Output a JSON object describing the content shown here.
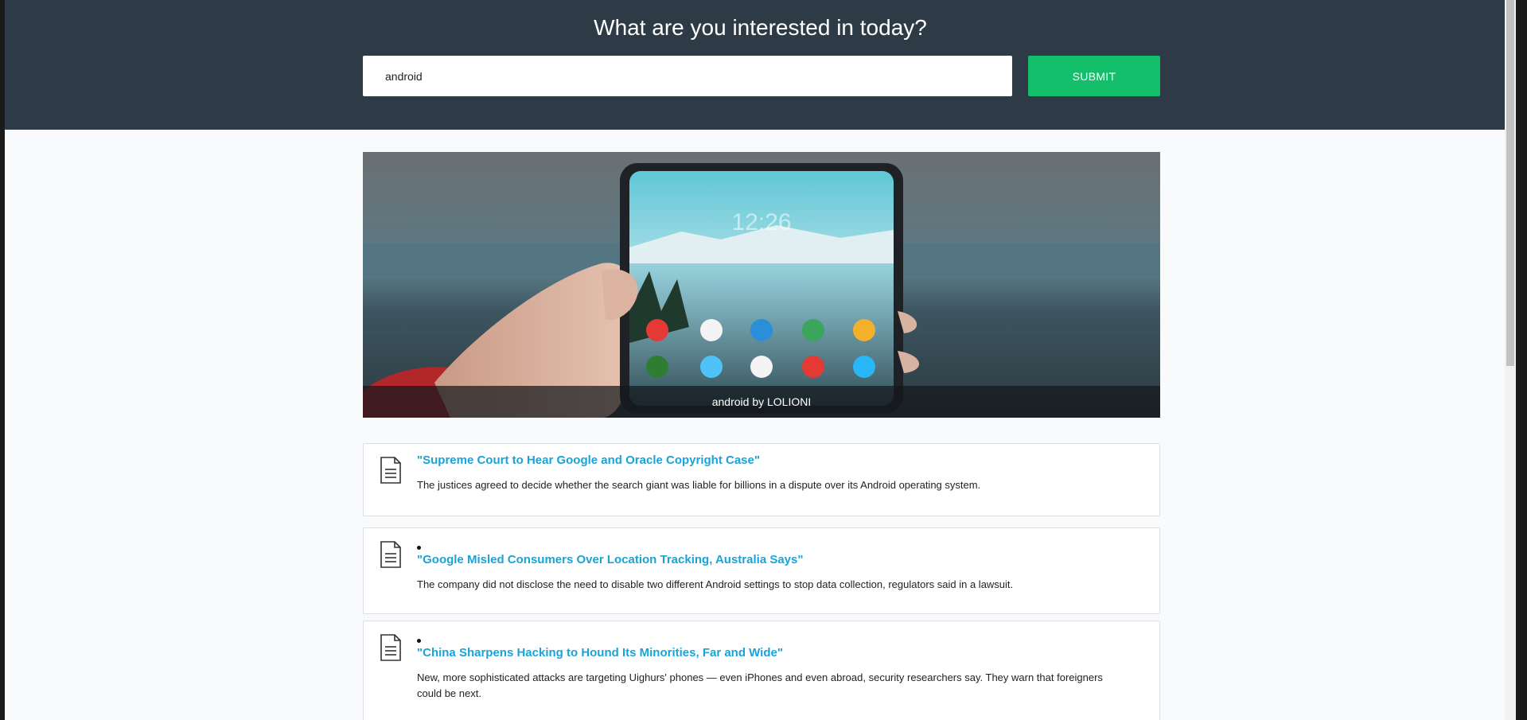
{
  "header": {
    "heading": "What are you interested in today?",
    "search_value": "android",
    "submit_label": "SUBMIT"
  },
  "hero": {
    "caption": "android by LOLIONI",
    "phone_clock": "12:26"
  },
  "articles": [
    {
      "title": "\"Supreme Court to Hear Google and Oracle Copyright Case\"",
      "description": "The justices agreed to decide whether the search giant was liable for billions in a dispute over its Android operating system."
    },
    {
      "title": "\"Google Misled Consumers Over Location Tracking, Australia Says\"",
      "description": "The company did not disclose the need to disable two different Android settings to stop data collection, regulators said in a lawsuit."
    },
    {
      "title": "\"China Sharpens Hacking to Hound Its Minorities, Far and Wide\"",
      "description": "New, more sophisticated attacks are targeting Uighurs' phones — even iPhones and even abroad, security researchers say. They warn that foreigners could be next."
    }
  ],
  "colors": {
    "header_bg": "#2e3a46",
    "accent_green": "#13bf6b",
    "link_blue": "#1aa3d6"
  }
}
